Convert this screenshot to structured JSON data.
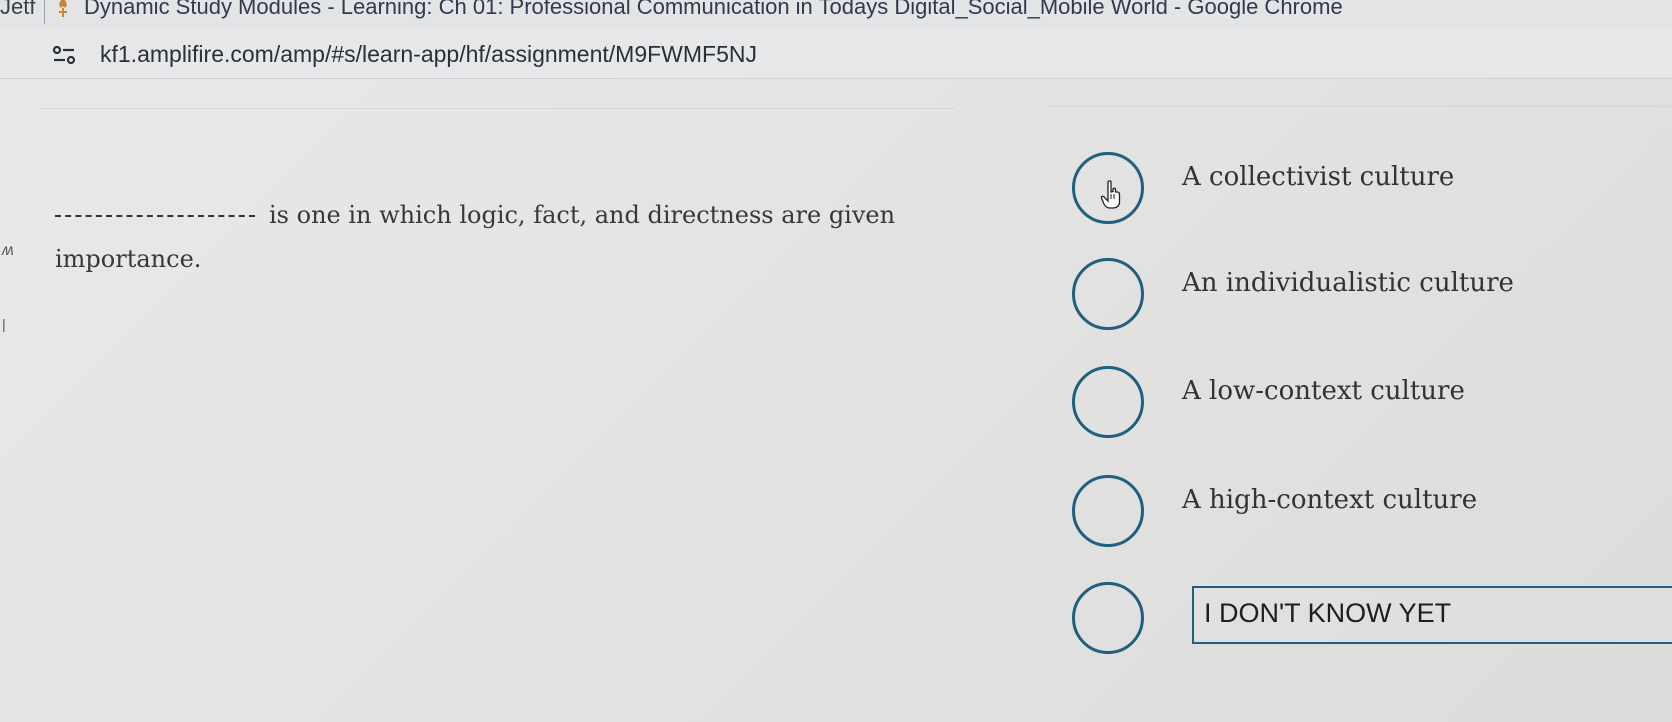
{
  "browser": {
    "prev_tab_fragment": "Jetf",
    "window_title": "Dynamic Study Modules - Learning: Ch 01: Professional Communication in Todays Digital_Social_Mobile World - Google Chrome",
    "url": "kf1.amplifire.com/amp/#s/learn-app/hf/assignment/M9FWMF5NJ"
  },
  "question": {
    "text": "is one in which logic, fact, and directness are given importance."
  },
  "options": [
    {
      "label": "A collectivist culture"
    },
    {
      "label": "An individualistic culture"
    },
    {
      "label": "A low-context culture"
    },
    {
      "label": "A high-context culture"
    }
  ],
  "dont_know": {
    "label": "I DON'T KNOW YET"
  },
  "colors": {
    "radio_border": "#1f5f7f",
    "favicon": "#c9872f"
  },
  "icons": {
    "favicon": "amplifire-flame-icon",
    "site_settings": "tune-icon",
    "cursor": "hand-pointer-icon"
  }
}
